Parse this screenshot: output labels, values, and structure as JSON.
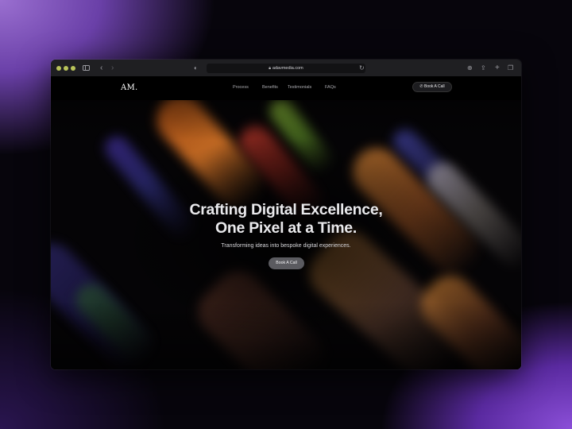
{
  "browser": {
    "url": "adavmedia.com"
  },
  "site": {
    "logo": "AM.",
    "nav": [
      "Process",
      "Benefits",
      "Testimonials",
      "FAQs"
    ],
    "nav_cta": "Book A Call"
  },
  "hero": {
    "headline_line1": "Crafting Digital Excellence,",
    "headline_line2": "One Pixel at a Time.",
    "subtitle": "Transforming ideas into bespoke digital experiences.",
    "cta": "Book A Call"
  },
  "colors": {
    "page_background_glow": "#7a4fc8",
    "window_chrome": "#1f1f22",
    "hero_cta": "#5b5b60"
  },
  "icons": {
    "sidebar": "sidebar-icon",
    "back": "chevron-left-icon",
    "forward": "chevron-right-icon",
    "privacy": "shield-icon",
    "lock": "lock-icon",
    "reload": "reload-icon",
    "download": "download-icon",
    "share": "share-icon",
    "new_tab": "plus-icon",
    "tabs": "tabs-icon",
    "phone": "phone-icon"
  }
}
